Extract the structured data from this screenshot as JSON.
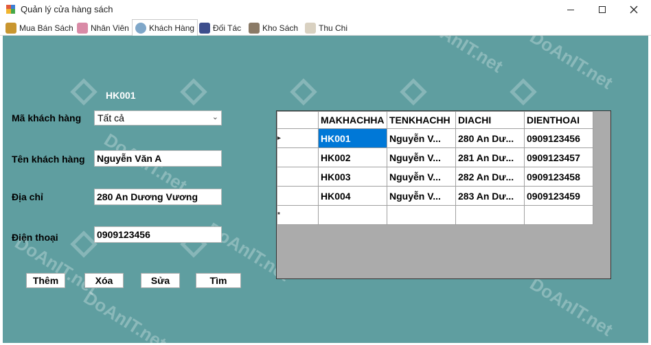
{
  "window": {
    "title": "Quản lý cửa hàng sách"
  },
  "tabs": [
    {
      "label": "Mua Bán Sách",
      "icon": "book-money-icon",
      "color": "#c9962f"
    },
    {
      "label": "Nhân Viên",
      "icon": "staff-icon",
      "color": "#d98aa6"
    },
    {
      "label": "Khách Hàng",
      "icon": "customer-icon",
      "color": "#7fa7c9"
    },
    {
      "label": "Đối Tác",
      "icon": "partner-icon",
      "color": "#3d4e8c"
    },
    {
      "label": "Kho Sách",
      "icon": "warehouse-icon",
      "color": "#8a7a66"
    },
    {
      "label": "Thu Chi",
      "icon": "finance-icon",
      "color": "#d9d1c1"
    }
  ],
  "active_tab": "Khách Hàng",
  "form": {
    "id_display": "HK001",
    "ma_label": "Mã khách hàng",
    "ma_value": "Tất cả",
    "ten_label": "Tên khách hàng",
    "ten_value": "Nguyễn Văn A",
    "diachi_label": "Địa chỉ",
    "diachi_value": "280 An Dương Vương",
    "dienthoai_label": "Điện thoại",
    "dienthoai_value": "0909123456"
  },
  "buttons": {
    "them": "Thêm",
    "xoa": "Xóa",
    "sua": "Sửa",
    "tim": "Tìm"
  },
  "grid": {
    "columns": [
      "MAKHACHHA",
      "TENKHACHH",
      "DIACHI",
      "DIENTHOAI"
    ],
    "rows": [
      {
        "ma": "HK001",
        "ten": "Nguyễn V...",
        "diachi": "280 An Dư...",
        "sdt": "0909123456",
        "indicator": "▸"
      },
      {
        "ma": "HK002",
        "ten": "Nguyễn V...",
        "diachi": "281 An Dư...",
        "sdt": "0909123457",
        "indicator": ""
      },
      {
        "ma": "HK003",
        "ten": "Nguyễn V...",
        "diachi": "282 An Dư...",
        "sdt": "0909123458",
        "indicator": ""
      },
      {
        "ma": "HK004",
        "ten": "Nguyễn V...",
        "diachi": "283 An Dư...",
        "sdt": "0909123459",
        "indicator": ""
      }
    ],
    "new_row_indicator": "*"
  },
  "watermark": {
    "text": "DoAnIT.net"
  },
  "colors": {
    "panel": "#5f9ea0",
    "selection": "#0078d7",
    "grid_background": "#ababab"
  }
}
